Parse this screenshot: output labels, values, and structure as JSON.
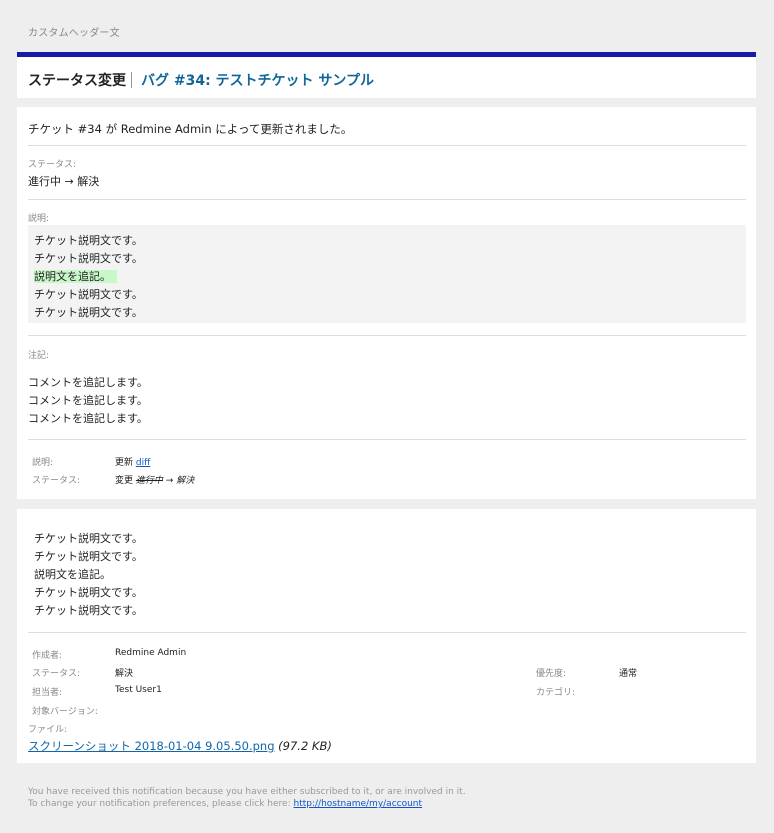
{
  "custom_header": "カスタムヘッダー文",
  "title": {
    "status_label": "ステータス変更",
    "issue_link": "バグ #34: テストチケット サンプル"
  },
  "update": {
    "summary": "チケット #34 が Redmine Admin によって更新されました。",
    "status_label": "ステータス:",
    "status_change": "進行中 → 解決",
    "description_label": "説明:",
    "description_lines": [
      {
        "text": "チケット説明文です。",
        "added": false
      },
      {
        "text": "チケット説明文です。",
        "added": false
      },
      {
        "text": "説明文を追記。",
        "added": true
      },
      {
        "text": "チケット説明文です。",
        "added": false
      },
      {
        "text": "チケット説明文です。",
        "added": false
      }
    ],
    "notes_label": "注記:",
    "notes_lines": [
      "コメントを追記します。",
      "コメントを追記します。",
      "コメントを追記します。"
    ],
    "details": {
      "desc_key": "説明:",
      "desc_value": "更新",
      "diff_link": "diff",
      "status_key": "ステータス:",
      "status_value_prefix": "変更",
      "status_old": "進行中",
      "status_arrow": "→",
      "status_new": "解決"
    }
  },
  "issue": {
    "description_lines": [
      "チケット説明文です。",
      "チケット説明文です。",
      "説明文を追記。",
      "チケット説明文です。",
      "チケット説明文です。"
    ],
    "attributes": {
      "author_label": "作成者:",
      "author": "Redmine Admin",
      "status_label": "ステータス:",
      "status": "解決",
      "priority_label": "優先度:",
      "priority": "通常",
      "assignee_label": "担当者:",
      "assignee": "Test User1",
      "category_label": "カテゴリ:",
      "category": "",
      "version_label": "対象バージョン:",
      "version": ""
    },
    "files_label": "ファイル:",
    "attachment_name": "スクリーンショット 2018-01-04 9.05.50.png",
    "attachment_size": "(97.2 KB)"
  },
  "footer": {
    "line1": "You have received this notification because you have either subscribed to it, or are involved in it.",
    "line2_prefix": "To change your notification preferences, please click here:",
    "link": "http://hostname/my/account"
  },
  "colors": {
    "header_bar": "#1a1aa8",
    "link": "#1166aa",
    "added_highlight": "#c8f7c8",
    "page_bg": "#eeeeee"
  }
}
